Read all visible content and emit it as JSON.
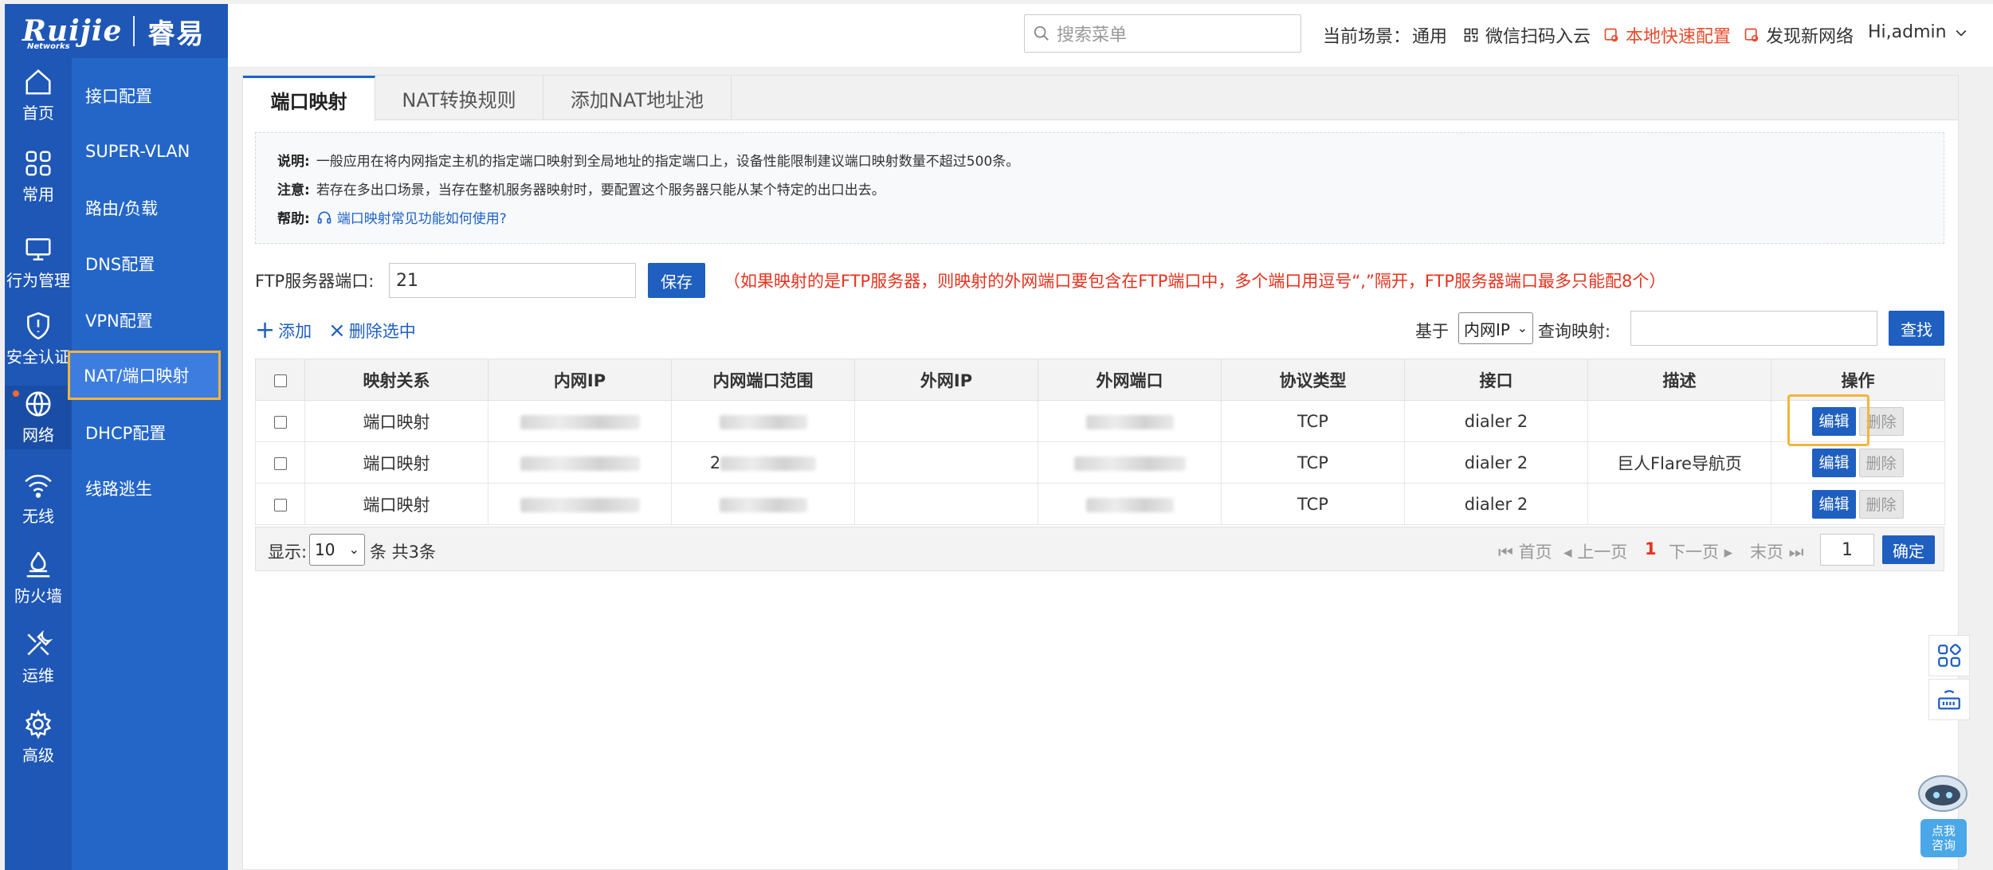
{
  "brand": {
    "logo_text": "Ruijie",
    "logo_sub": "Networks",
    "product": "睿易"
  },
  "rail": [
    {
      "label": "首页",
      "icon": "home-icon"
    },
    {
      "label": "常用",
      "icon": "grid-icon"
    },
    {
      "label": "行为管理",
      "icon": "monitor-icon"
    },
    {
      "label": "安全认证",
      "icon": "shield-icon"
    },
    {
      "label": "网络",
      "icon": "globe-icon"
    },
    {
      "label": "无线",
      "icon": "wifi-icon"
    },
    {
      "label": "防火墙",
      "icon": "firewall-icon"
    },
    {
      "label": "运维",
      "icon": "tools-icon"
    },
    {
      "label": "高级",
      "icon": "gear-icon"
    }
  ],
  "submenu": [
    {
      "label": "接口配置"
    },
    {
      "label": "SUPER-VLAN"
    },
    {
      "label": "路由/负载"
    },
    {
      "label": "DNS配置"
    },
    {
      "label": "VPN配置"
    },
    {
      "label": "NAT/端口映射"
    },
    {
      "label": "DHCP配置"
    },
    {
      "label": "线路逃生"
    }
  ],
  "header": {
    "search_placeholder": "搜索菜单",
    "scene_label": "当前场景：",
    "scene_value": "通用",
    "wechat": "微信扫码入云",
    "quick_config": "本地快速配置",
    "discover": "发现新网络",
    "user": "Hi,admin"
  },
  "tabs": [
    {
      "label": "端口映射"
    },
    {
      "label": "NAT转换规则"
    },
    {
      "label": "添加NAT地址池"
    }
  ],
  "notes": {
    "desc_label": "说明:",
    "desc_text": "一般应用在将内网指定主机的指定端口映射到全局地址的指定端口上，设备性能限制建议端口映射数量不超过500条。",
    "warn_label": "注意:",
    "warn_text": "若存在多出口场景，当存在整机服务器映射时，要配置这个服务器只能从某个特定的出口出去。",
    "help_label": "帮助:",
    "help_text": "端口映射常见功能如何使用?"
  },
  "ftp": {
    "label": "FTP服务器端口:",
    "value": "21",
    "save": "保存",
    "hint": "（如果映射的是FTP服务器，则映射的外网端口要包含在FTP端口中，多个端口用逗号“,”隔开，FTP服务器端口最多只能配8个）"
  },
  "toolbar": {
    "add": "添加",
    "delete_selected": "删除选中",
    "base_label": "基于",
    "base_value": "内网IP",
    "query_label": "查询映射:",
    "query_value": "",
    "find": "查找"
  },
  "table": {
    "headers": [
      "映射关系",
      "内网IP",
      "内网端口范围",
      "外网IP",
      "外网端口",
      "协议类型",
      "接口",
      "描述",
      "操作"
    ],
    "rows": [
      {
        "type": "端口映射",
        "port_prefix": "",
        "protocol": "TCP",
        "iface": "dialer 2",
        "desc": ""
      },
      {
        "type": "端口映射",
        "port_prefix": "2",
        "protocol": "TCP",
        "iface": "dialer 2",
        "desc": "巨人Flare导航页"
      },
      {
        "type": "端口映射",
        "port_prefix": "",
        "protocol": "TCP",
        "iface": "dialer 2",
        "desc": ""
      }
    ],
    "edit": "编辑",
    "delete": "删除"
  },
  "pager": {
    "show_label": "显示:",
    "page_size": "10",
    "summary": "条 共3条",
    "first": "首页",
    "prev": "上一页",
    "current": "1",
    "next": "下一页",
    "last": "末页",
    "goto_value": "1",
    "confirm": "确定"
  },
  "assistant": {
    "line1": "点我",
    "line2": "咨询"
  },
  "colors": {
    "primary": "#1e57b6",
    "submenu": "#2466c8",
    "accent": "#1e5fbf",
    "warning": "#e8321e",
    "highlight": "#f5b43c"
  }
}
